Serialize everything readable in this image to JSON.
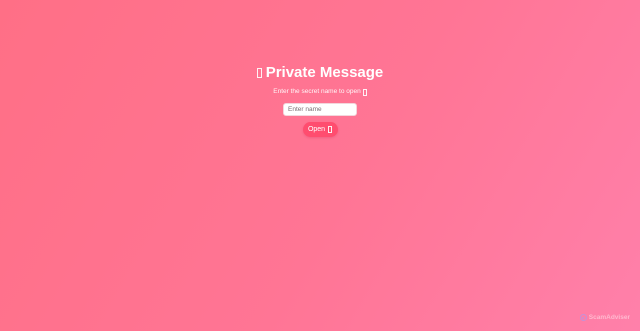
{
  "card": {
    "title_icon": "missing-glyph-icon",
    "title": "Private Message",
    "prompt": "Enter the secret name to open",
    "prompt_icon": "missing-glyph-icon"
  },
  "name_input": {
    "value": "",
    "placeholder": "Enter name"
  },
  "open_button": {
    "label": "Open",
    "icon": "missing-glyph-icon"
  },
  "watermark": {
    "logo_icon": "scam-detector-logo-icon",
    "text": "ScamAdviser"
  },
  "colors": {
    "background_start": "#ff6f86",
    "background_end": "#ff80aa",
    "button": "#ff4d6f",
    "text": "#ffffff"
  }
}
